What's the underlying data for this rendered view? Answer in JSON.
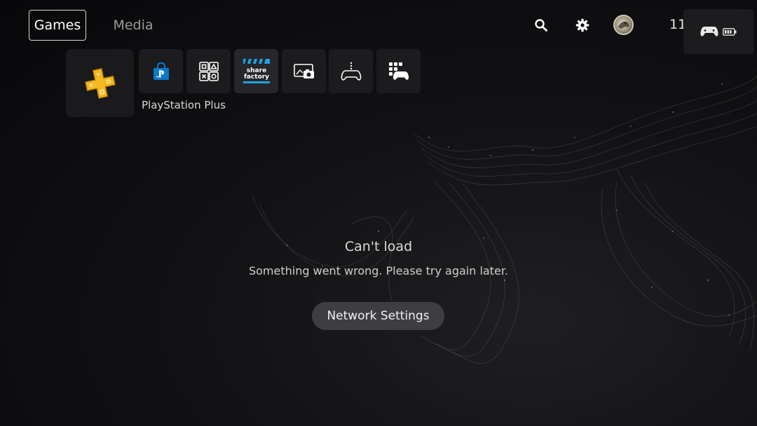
{
  "nav": {
    "tabs": [
      {
        "label": "Games",
        "selected": true
      },
      {
        "label": "Media",
        "selected": false
      }
    ],
    "icons": [
      "search-icon",
      "settings-icon"
    ],
    "clock": "11:"
  },
  "tiles": [
    {
      "name": "playstation-plus",
      "icon": "ps-plus-icon",
      "caption": "PlayStation Plus"
    },
    {
      "name": "playstation-store",
      "icon": "ps-store-icon"
    },
    {
      "name": "game-library",
      "icon": "game-library-icon"
    },
    {
      "name": "share-factory",
      "icon": "share-factory-icon",
      "text": "share factory"
    },
    {
      "name": "media-gallery",
      "icon": "media-gallery-icon"
    },
    {
      "name": "remote-play",
      "icon": "remote-play-icon"
    },
    {
      "name": "game-base",
      "icon": "game-base-icon"
    }
  ],
  "message": {
    "title": "Can't load",
    "subtitle": "Something went wrong. Please try again later.",
    "button": "Network Settings"
  },
  "colors": {
    "background": "#0b0b0d",
    "tile": "#1c1c1f",
    "button": "#3e3e42",
    "ps_plus_gold": "#f5b81e",
    "store_blue": "#0a79c8",
    "share_blue": "#1fa3e0"
  }
}
